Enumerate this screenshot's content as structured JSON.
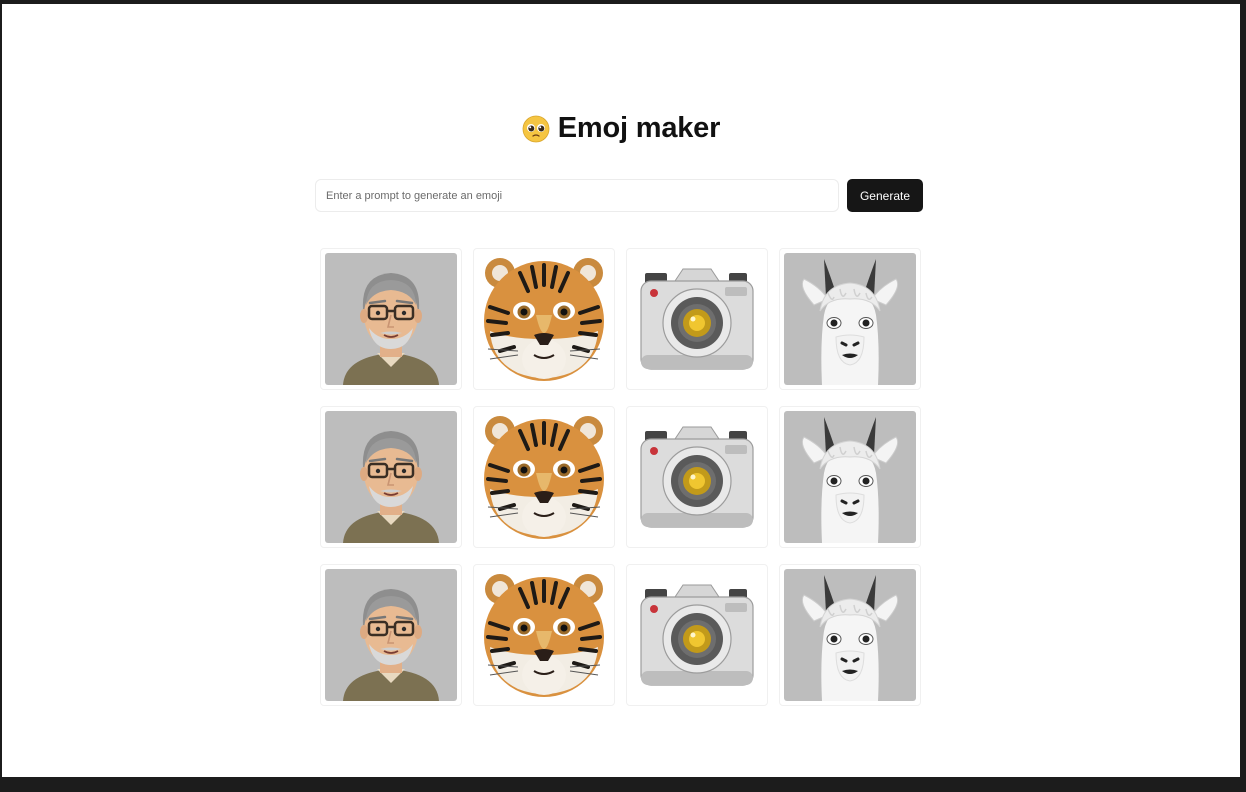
{
  "app": {
    "title": "Emoj maker",
    "title_icon": "pleading-face-icon"
  },
  "prompt": {
    "placeholder": "Enter a prompt to generate an emoji",
    "button_label": "Generate"
  },
  "grid": {
    "rows": [
      [
        "man-with-glasses-emoji",
        "tiger-emoji",
        "camera-emoji",
        "llama-emoji"
      ],
      [
        "man-with-glasses-emoji",
        "tiger-emoji",
        "camera-emoji",
        "llama-emoji"
      ],
      [
        "man-with-glasses-emoji",
        "tiger-emoji",
        "camera-emoji",
        "llama-emoji"
      ]
    ]
  },
  "colors": {
    "button_bg": "#161616",
    "frame_bg": "#1c1c1c",
    "tile_bg": "#bdbdbd"
  }
}
